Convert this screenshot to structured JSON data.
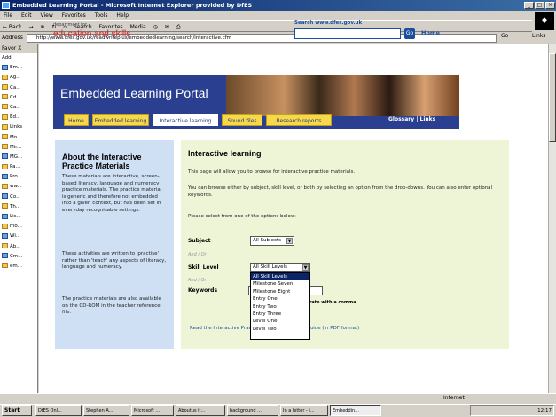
{
  "window": {
    "title": "Embedded Learning Portal - Microsoft Internet Explorer provided by DfES"
  },
  "menu": [
    "File",
    "Edit",
    "View",
    "Favorites",
    "Tools",
    "Help"
  ],
  "toolbar": {
    "back": "← Back",
    "search": "Search",
    "favorites": "Favorites",
    "media": "Media"
  },
  "address": {
    "label": "Address",
    "url": "http://www.dfes.gov.uk/readwriteplus/embeddedlearning/search/interactive.cfm",
    "go": "Go",
    "links": "Links"
  },
  "favorites": {
    "header": "Favor X",
    "add": "Add",
    "items": [
      "Em...",
      "Ag...",
      "Ca...",
      "Cd...",
      "Ca...",
      "Ed...",
      "Links",
      "Mo...",
      "Mir...",
      "MG...",
      "Pa...",
      "Pro...",
      "ww...",
      "Co...",
      "Th...",
      "Lis...",
      "mo...",
      "Wi...",
      "Ab...",
      "Cm...",
      "em..."
    ]
  },
  "site": {
    "dept_prefix": "department for",
    "dept_name": "education and skills",
    "search_label": "Search www.dfes.gov.uk",
    "search_go": "Go",
    "home_link": "Home",
    "banner_title": "Embedded Learning Portal",
    "tabs": [
      "Home",
      "Embedded learning",
      "Interactive learning",
      "Sound files",
      "Research reports"
    ],
    "links_right": "Glossary | Links"
  },
  "sidebar": {
    "title": "About the Interactive Practice Materials",
    "p1": "These materials are interactive, screen-based literacy, language and numeracy practice materials. The practice material is generic and therefore not embedded into a given context, but has been set in everyday recognisable settings.",
    "p2": "These activities are written to 'practise' rather than 'teach' any aspects of literacy, language and numeracy.",
    "p3": "The practice materials are also available on the CD-ROM in the teacher reference file."
  },
  "main": {
    "title": "Interactive learning",
    "intro": "This page will allow you to browse for interactive practice materials.",
    "instr": "You can browse either by subject, skill level, or both by selecting an option from the drop-downs. You can also enter optional keywords.",
    "prompt": "Please select from one of the options below:",
    "subject_label": "Subject",
    "subject_value": "All Subjects",
    "andor1": "And / Or",
    "skill_label": "Skill Level",
    "skill_value": "All Skill Levels",
    "andor2": "And / Or",
    "kw_label": "Keywords",
    "kw_hint": "Separate with a comma",
    "skill_options": [
      "All Skill Levels",
      "Milestone Seven",
      "Milestone Eight",
      "Entry One",
      "Entry Two",
      "Entry Three",
      "Level One",
      "Level Two"
    ],
    "pdf_text": "Read the Interactive Practice Materials Teacher Guide (in PDF format)"
  },
  "status": {
    "left": "",
    "zone": "Internet"
  },
  "taskbar": {
    "start": "Start",
    "tasks": [
      "DfES Onl...",
      "Stephen A...",
      "Microsoft ...",
      "Aboutus it...",
      "background ...",
      "In a letter - i...",
      "Embeddin..."
    ],
    "tray": "12:17"
  }
}
